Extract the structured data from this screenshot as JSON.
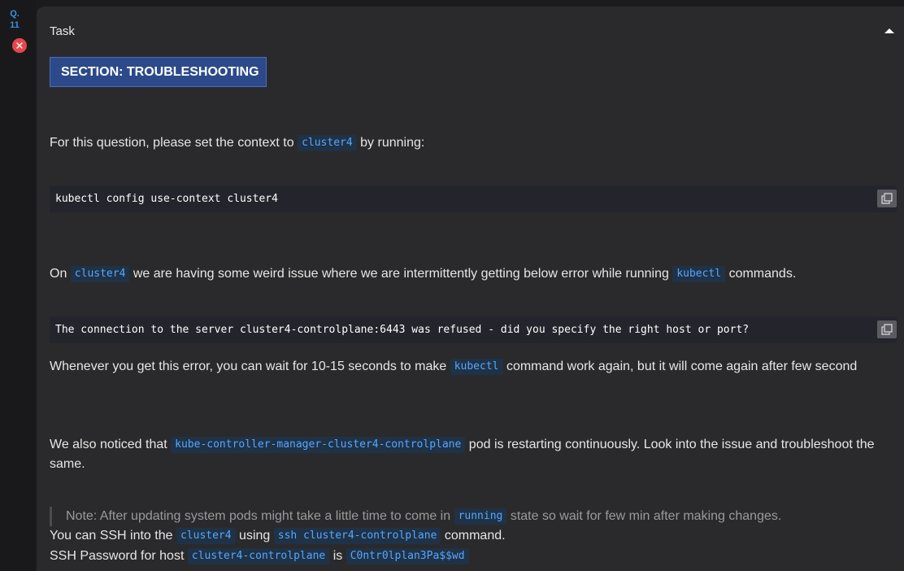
{
  "sidebar": {
    "question_prefix": "Q.",
    "question_number": "11",
    "status": "incorrect"
  },
  "task": {
    "header": "Task",
    "section_badge": "SECTION: TROUBLESHOOTING",
    "p1": {
      "before": "For this question, please set the context to",
      "code": "cluster4",
      "after": "by running:"
    },
    "code_block_1": "kubectl config use-context cluster4",
    "p2": {
      "t1": "On",
      "c1": "cluster4",
      "t2": "we are having some weird issue where we are intermittently getting below error while running",
      "c2": "kubectl",
      "t3": "commands."
    },
    "code_block_2": "The connection to the server cluster4-controlplane:6443 was refused - did you specify the right host or port?",
    "p3": {
      "t1": "Whenever you get this error, you can wait for 10-15 seconds to make",
      "c1": "kubectl",
      "t2": "command work again, but it will come again after few second"
    },
    "p4": {
      "t1": "We also noticed that",
      "c1": "kube-controller-manager-cluster4-controlplane",
      "t2": "pod is restarting continuously. Look into the issue and troubleshoot the same."
    },
    "note": {
      "t1": "Note: After updating system pods might take a little time to come in",
      "c1": "running",
      "t2": "state so wait for few min after making changes."
    },
    "ssh_line": {
      "t1": "You can SSH into the",
      "c1": "cluster4",
      "t2": "using",
      "c2": "ssh cluster4-controlplane",
      "t3": "command."
    },
    "password_line": {
      "t1": "SSH Password for host",
      "c1": "cluster4-controlplane",
      "t2": "is",
      "c2": "C0ntr0lplan3Pa$$wd"
    }
  },
  "colors": {
    "accent_blue": "#3b8fe0",
    "error_red": "#e4484c",
    "badge_bg": "#2c4a8a",
    "inline_code": "#58a6ff"
  },
  "icons": {
    "status": "x-circle-icon",
    "collapse": "chevron-up-icon",
    "copy": "copy-icon"
  }
}
